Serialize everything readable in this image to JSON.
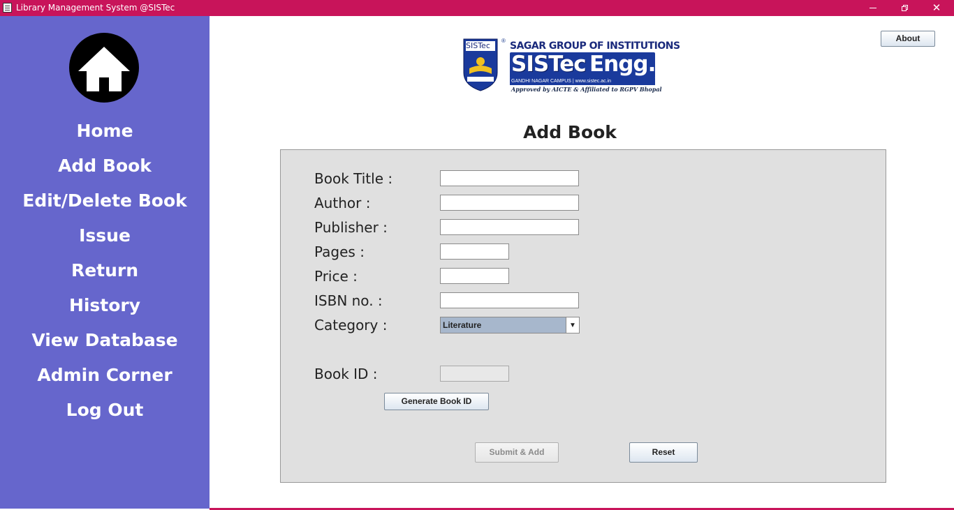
{
  "window": {
    "title": "Library Management System @SISTec",
    "controls": {
      "minimize": "minimize",
      "maximize": "restore",
      "close": "close"
    }
  },
  "sidebar": {
    "background": "#6666cc",
    "home_icon": "home-icon",
    "items": [
      {
        "label": "Home"
      },
      {
        "label": "Add Book"
      },
      {
        "label": "Edit/Delete Book"
      },
      {
        "label": "Issue"
      },
      {
        "label": "Return"
      },
      {
        "label": "History"
      },
      {
        "label": "View Database"
      },
      {
        "label": "Admin Corner"
      },
      {
        "label": "Log Out"
      }
    ]
  },
  "logo": {
    "badge_text": "SISTec",
    "line1": "SAGAR GROUP OF INSTITUTIONS",
    "brand_left": "SISTec",
    "brand_right": "Engg.",
    "campus": "GANDHI NAGAR CAMPUS | www.sistec.ac.in",
    "approval": "Approved by AICTE & Affiliated to RGPV Bhopal"
  },
  "header": {
    "about_label": "About"
  },
  "page": {
    "title": "Add Book"
  },
  "form": {
    "book_title": {
      "label": "Book Title :",
      "value": ""
    },
    "author": {
      "label": "Author :",
      "value": ""
    },
    "publisher": {
      "label": "Publisher :",
      "value": ""
    },
    "pages": {
      "label": "Pages :",
      "value": ""
    },
    "price": {
      "label": "Price :",
      "value": ""
    },
    "isbn": {
      "label": "ISBN no. :",
      "value": ""
    },
    "category": {
      "label": "Category :",
      "selected": "Literature"
    },
    "book_id": {
      "label": "Book ID :",
      "value": ""
    },
    "generate_label": "Generate Book ID",
    "submit_label": "Submit & Add",
    "reset_label": "Reset"
  },
  "colors": {
    "titlebar": "#c8145a",
    "sidebar": "#6666cc",
    "panel": "#e0e0e0"
  }
}
